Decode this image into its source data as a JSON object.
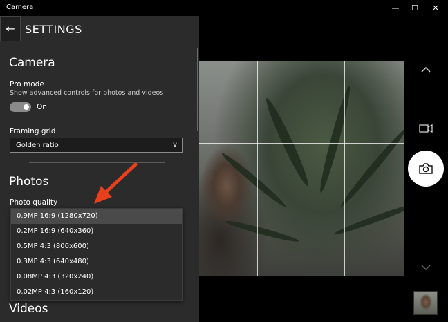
{
  "window": {
    "title": "Camera",
    "minimize_glyph": "—",
    "maximize_glyph": "☐",
    "close_glyph": "✕"
  },
  "settings": {
    "back_glyph": "←",
    "title": "SETTINGS",
    "camera": {
      "heading": "Camera",
      "pro_mode_label": "Pro mode",
      "pro_mode_desc": "Show advanced controls for photos and videos",
      "pro_mode_state": "On",
      "framing_grid_label": "Framing grid",
      "framing_grid_value": "Golden ratio",
      "select_chevron": "∨"
    },
    "photos": {
      "heading": "Photos",
      "photo_quality_label": "Photo quality",
      "options": [
        "0.9MP 16:9 (1280x720)",
        "0.2MP 16:9 (640x360)",
        "0.5MP 4:3 (800x600)",
        "0.3MP 4:3 (640x480)",
        "0.08MP 4:3 (320x240)",
        "0.02MP 4:3 (160x120)"
      ],
      "selected_index": 0
    },
    "videos": {
      "heading": "Videos"
    }
  },
  "controls": {
    "chevron_up_icon": "chevron-up-icon",
    "video_icon": "video-camera-icon",
    "shutter_icon": "camera-icon",
    "chevron_down_icon": "chevron-down-icon",
    "accent_arrow_color": "#e8401c"
  }
}
